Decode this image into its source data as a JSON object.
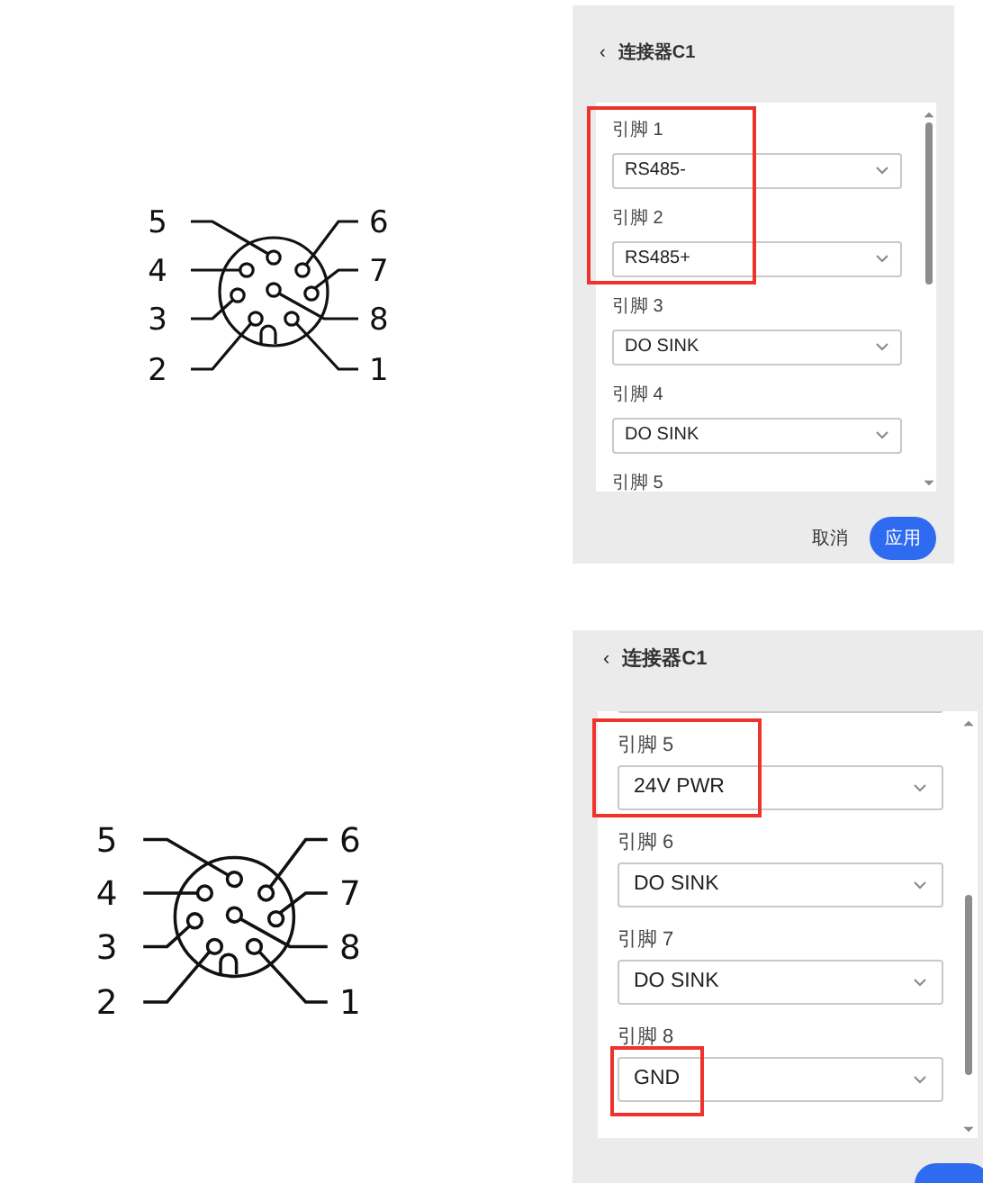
{
  "sections": [
    {
      "connector": {
        "pin_numbers": [
          "5",
          "6",
          "4",
          "7",
          "3",
          "8",
          "2",
          "1"
        ]
      },
      "panel": {
        "back": "‹",
        "title": "连接器C1",
        "partial_field_above": false,
        "footer_cut_off": false,
        "pins": [
          {
            "label": "引脚 1",
            "value": "RS485-",
            "label_highlighted": true,
            "field_highlighted": true
          },
          {
            "label": "引脚 2",
            "value": "RS485+",
            "label_highlighted": true,
            "field_highlighted": true
          },
          {
            "label": "引脚 3",
            "value": "DO SINK",
            "label_highlighted": false,
            "field_highlighted": false
          },
          {
            "label": "引脚 4",
            "value": "DO SINK",
            "label_highlighted": false,
            "field_highlighted": false
          },
          {
            "label": "引脚 5",
            "label_highlighted": false
          }
        ],
        "buttons": [
          {
            "label": "取消",
            "kind": "text"
          },
          {
            "label": "应用",
            "kind": "primary"
          }
        ]
      }
    },
    {
      "connector": {
        "pin_numbers": [
          "5",
          "6",
          "4",
          "7",
          "3",
          "8",
          "2",
          "1"
        ]
      },
      "panel": {
        "back": "‹",
        "title": "连接器C1",
        "partial_field_above": true,
        "footer_cut_off": true,
        "pins": [
          {
            "label": "引脚 5",
            "value": "24V PWR",
            "label_highlighted": true,
            "field_highlighted": true
          },
          {
            "label": "引脚 6",
            "value": "DO SINK",
            "label_highlighted": false,
            "field_highlighted": false
          },
          {
            "label": "引脚 7",
            "value": "DO SINK",
            "label_highlighted": false,
            "field_highlighted": false
          },
          {
            "label": "引脚 8",
            "value": "GND",
            "label_highlighted": false,
            "field_highlighted": true
          }
        ]
      }
    }
  ]
}
